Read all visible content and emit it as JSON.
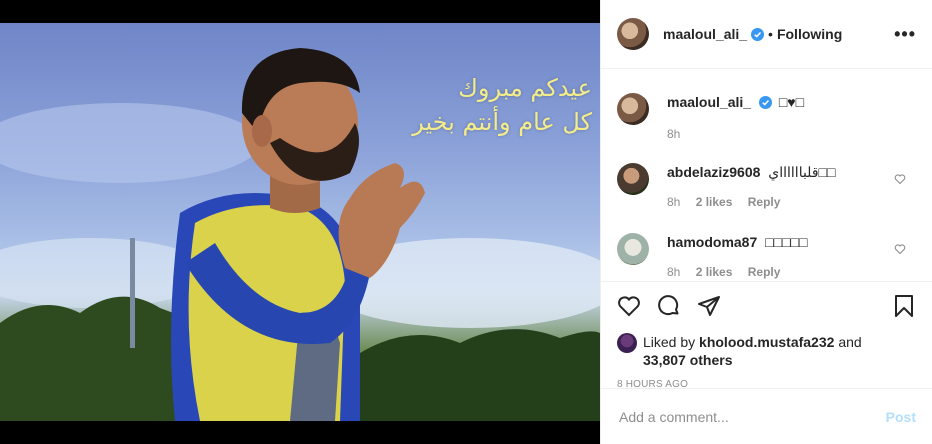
{
  "post": {
    "author": {
      "username": "maaloul_ali_",
      "verified": true,
      "follow_status": "Following",
      "separator": "•"
    },
    "image_text": {
      "line1": "عيدكم مبروك",
      "line2": "كل عام وأنتم بخير"
    },
    "caption": {
      "username": "maaloul_ali_",
      "text": "□♥□",
      "time": "8h"
    },
    "comments": [
      {
        "username": "abdelaziz9608",
        "text": "قلبااااااي□□",
        "time": "8h",
        "likes": "2 likes",
        "reply": "Reply"
      },
      {
        "username": "hamodoma87",
        "text": "□□□□□",
        "time": "8h",
        "likes": "2 likes",
        "reply": "Reply"
      }
    ],
    "likes": {
      "prefix": "Liked by",
      "user": "kholood.mustafa232",
      "and": "and",
      "others": "33,807 others"
    },
    "time_ago": "8 HOURS AGO",
    "add_comment": {
      "placeholder": "Add a comment...",
      "post_label": "Post"
    },
    "more_label": "•••",
    "colors": {
      "verified": "#3897f0",
      "post_disabled": "#b2dffc",
      "greeting": "#f3ec8a"
    }
  }
}
